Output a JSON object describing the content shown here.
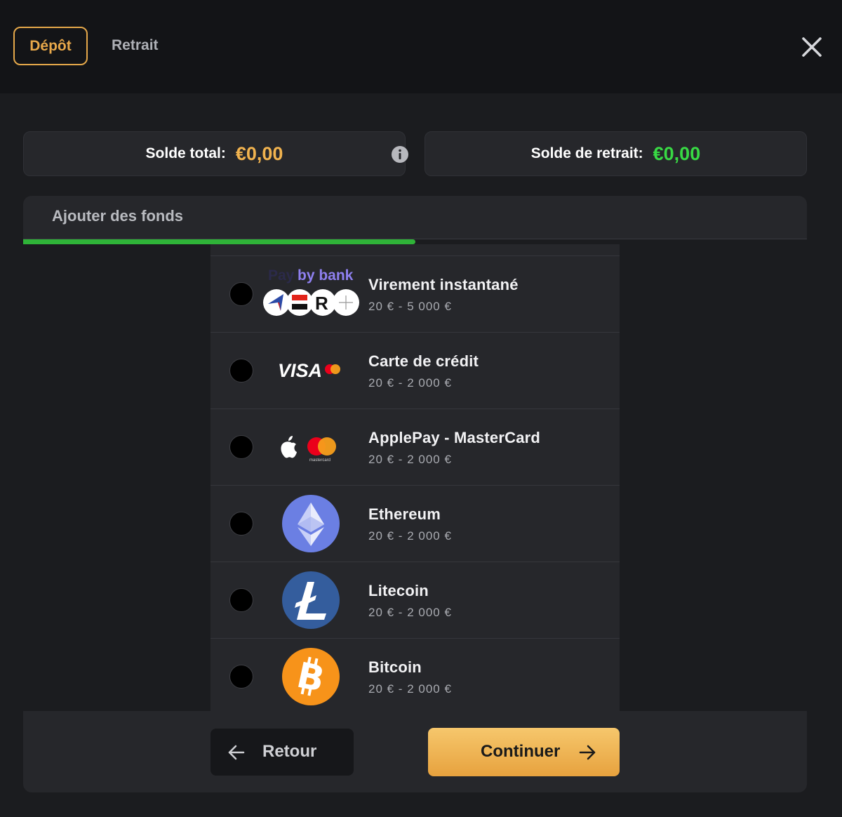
{
  "header": {
    "tabs": [
      {
        "label": "Dépôt",
        "active": true
      },
      {
        "label": "Retrait",
        "active": false
      }
    ],
    "close_icon": "close-icon"
  },
  "balances": {
    "total": {
      "label": "Solde total:",
      "amount": "€0,00",
      "color": "#f1b34f",
      "icon": "info-icon"
    },
    "withdraw": {
      "label": "Solde de retrait:",
      "amount": "€0,00",
      "color": "#38d944"
    }
  },
  "panel": {
    "title": "Ajouter des fonds",
    "progress": 0.5,
    "accent": "#2fb338"
  },
  "methods": [
    {
      "name": "Virement instantané",
      "range": "20 € - 5 000 €",
      "logo": "paybybank-logo",
      "logo_text": "Pay by bank",
      "selected": false
    },
    {
      "name": "Carte de crédit",
      "range": "20 € - 2 000 €",
      "logo": "visa-mastercard-logo",
      "logo_text": "VISA",
      "selected": false
    },
    {
      "name": "ApplePay - MasterCard",
      "range": "20 € - 2 000 €",
      "logo": "applepay-mastercard-logo",
      "logo_text": "mastercard",
      "selected": false
    },
    {
      "name": "Ethereum",
      "range": "20 € - 2 000 €",
      "logo": "ethereum-icon",
      "selected": false
    },
    {
      "name": "Litecoin",
      "range": "20 € - 2 000 €",
      "logo": "litecoin-icon",
      "selected": false
    },
    {
      "name": "Bitcoin",
      "range": "20 € - 2 000 €",
      "logo": "bitcoin-icon",
      "selected": false
    }
  ],
  "footer": {
    "back_label": "Retour",
    "continue_label": "Continuer"
  }
}
